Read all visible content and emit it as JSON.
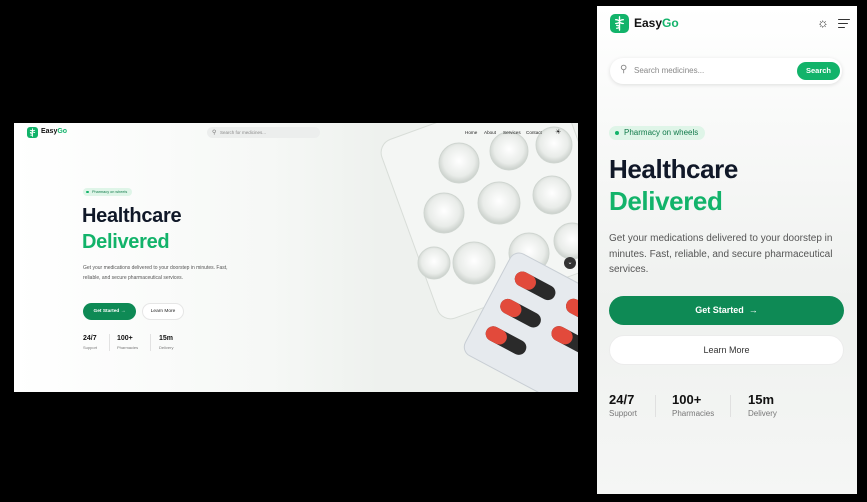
{
  "brand": {
    "name_a": "Easy",
    "name_b": "Go",
    "logo_icon": "caduceus-icon",
    "accent": "#12b36a",
    "accent_dark": "#0e8a55"
  },
  "search": {
    "placeholder_desktop": "Search for medicines...",
    "placeholder_mobile": "Search medicines...",
    "button_label": "Search"
  },
  "nav": {
    "items": [
      "Home",
      "About",
      "Services",
      "Contact"
    ],
    "theme_icon": "sun-icon",
    "menu_icon": "menu-icon"
  },
  "hero": {
    "badge": "Pharmacy on wheels",
    "title_line1": "Healthcare",
    "title_line2": "Delivered",
    "description": "Get your medications delivered to your doorstep in minutes. Fast, reliable, and secure pharmaceutical services.",
    "cta_primary": "Get Started",
    "cta_secondary": "Learn More"
  },
  "stats": [
    {
      "value": "24/7",
      "label": "Support"
    },
    {
      "value": "100+",
      "label": "Pharmacies"
    },
    {
      "value": "15m",
      "label": "Delivery"
    }
  ]
}
